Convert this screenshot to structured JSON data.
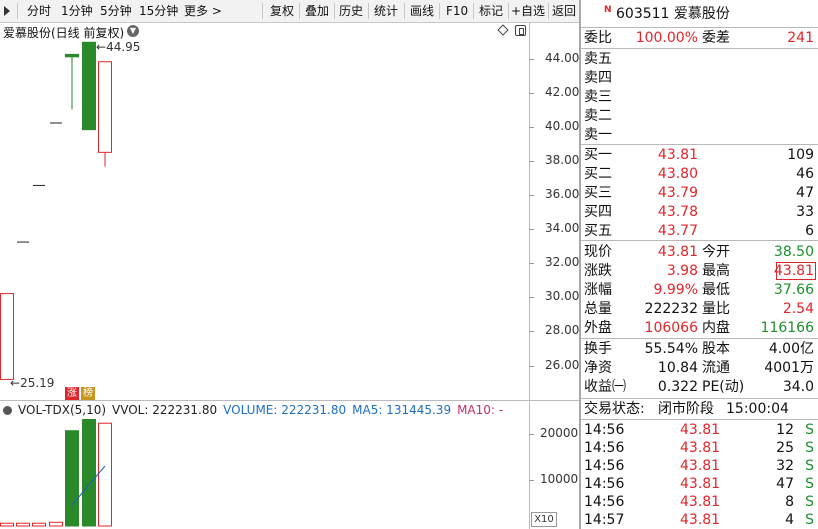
{
  "toolbar": {
    "items": [
      "分时",
      "1分钟",
      "5分钟",
      "15分钟",
      "更多 >",
      "复权",
      "叠加",
      "历史",
      "统计",
      "画线",
      "F10",
      "标记",
      "+自选",
      "返回"
    ]
  },
  "chart": {
    "title": "爱慕股份(日线 前复权)",
    "high_label": "44.95",
    "low_label": "25.19",
    "tags": [
      "涨",
      "榜"
    ],
    "y_ticks": [
      "44.00",
      "42.00",
      "40.00",
      "38.00",
      "36.00",
      "34.00",
      "32.00",
      "30.00",
      "28.00",
      "26.00"
    ],
    "candles": [
      {
        "open": 25.19,
        "close": 30.22,
        "high": 30.22,
        "low": 25.19
      },
      {
        "open": 33.24,
        "close": 33.24,
        "high": 33.24,
        "low": 33.24
      },
      {
        "open": 36.56,
        "close": 36.56,
        "high": 36.56,
        "low": 36.56
      },
      {
        "open": 40.22,
        "close": 40.22,
        "high": 40.22,
        "low": 40.22
      },
      {
        "open": 44.24,
        "close": 44.1,
        "high": 44.24,
        "low": 41.0
      },
      {
        "open": 44.95,
        "close": 39.83,
        "high": 44.95,
        "low": 39.83
      },
      {
        "open": 38.5,
        "close": 43.81,
        "high": 43.81,
        "low": 37.66
      }
    ],
    "colors": {
      "up": "#e0262b",
      "down": "#2a8a2a",
      "ma": "#1e5fb8"
    }
  },
  "volume": {
    "indicator": "VOL-TDX(5,10)",
    "vvol": "VVOL: 222231.80",
    "volume_text": "VOLUME: 222231.80",
    "ma5_text": "MA5: 131445.39",
    "ma10_text": "MA10: -",
    "y_ticks": [
      "20000",
      "10000"
    ],
    "multiplier": "X10",
    "values": [
      600,
      600,
      600,
      800,
      20600,
      26000,
      22223
    ]
  },
  "quote": {
    "badge": "N",
    "code": "603511",
    "name": "爱慕股份",
    "webi_label": "委比",
    "webi_value": "100.00%",
    "weicha_label": "委差",
    "weicha_value": "241",
    "sells": [
      {
        "label": "卖五",
        "price": "",
        "vol": ""
      },
      {
        "label": "卖四",
        "price": "",
        "vol": ""
      },
      {
        "label": "卖三",
        "price": "",
        "vol": ""
      },
      {
        "label": "卖二",
        "price": "",
        "vol": ""
      },
      {
        "label": "卖一",
        "price": "",
        "vol": ""
      }
    ],
    "buys": [
      {
        "label": "买一",
        "price": "43.81",
        "vol": "109"
      },
      {
        "label": "买二",
        "price": "43.80",
        "vol": "46"
      },
      {
        "label": "买三",
        "price": "43.79",
        "vol": "47"
      },
      {
        "label": "买四",
        "price": "43.78",
        "vol": "33"
      },
      {
        "label": "买五",
        "price": "43.77",
        "vol": "6"
      }
    ],
    "stats": [
      {
        "l1": "现价",
        "v1": "43.81",
        "l2": "今开",
        "v2": "38.50"
      },
      {
        "l1": "涨跌",
        "v1": "3.98",
        "l2": "最高",
        "v2": "43.81"
      },
      {
        "l1": "涨幅",
        "v1": "9.99%",
        "l2": "最低",
        "v2": "37.66"
      },
      {
        "l1": "总量",
        "v1": "222232",
        "l2": "量比",
        "v2": "2.54"
      },
      {
        "l1": "外盘",
        "v1": "106066",
        "l2": "内盘",
        "v2": "116166"
      }
    ],
    "fundamentals": [
      {
        "l1": "换手",
        "v1": "55.54%",
        "l2": "股本",
        "v2": "4.00亿"
      },
      {
        "l1": "净资",
        "v1": "10.84",
        "l2": "流通",
        "v2": "4001万"
      },
      {
        "l1": "收益㈠",
        "v1": "0.322",
        "l2": "PE(动)",
        "v2": "34.0"
      }
    ],
    "status_label": "交易状态:",
    "status_value": "闭市阶段",
    "status_time": "15:00:04"
  },
  "ticks": [
    {
      "time": "14:56",
      "price": "43.81",
      "vol": "12",
      "side": "S"
    },
    {
      "time": "14:56",
      "price": "43.81",
      "vol": "25",
      "side": "S"
    },
    {
      "time": "14:56",
      "price": "43.81",
      "vol": "32",
      "side": "S"
    },
    {
      "time": "14:56",
      "price": "43.81",
      "vol": "47",
      "side": "S"
    },
    {
      "time": "14:56",
      "price": "43.81",
      "vol": "8",
      "side": "S"
    },
    {
      "time": "14:57",
      "price": "43.81",
      "vol": "4",
      "side": "S"
    }
  ]
}
